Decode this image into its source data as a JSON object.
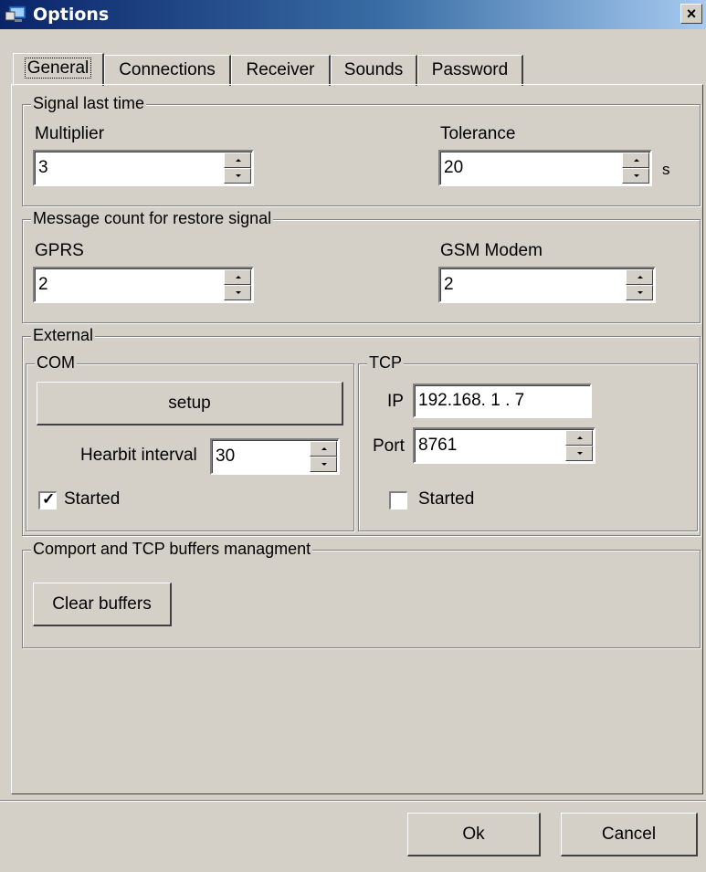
{
  "window": {
    "title": "Options",
    "close_glyph": "×",
    "icon": "monitor-app-icon"
  },
  "tabs": [
    {
      "label": "General",
      "active": true
    },
    {
      "label": "Connections",
      "active": false
    },
    {
      "label": "Receiver",
      "active": false
    },
    {
      "label": "Sounds",
      "active": false
    },
    {
      "label": "Password",
      "active": false
    }
  ],
  "signal_last_time": {
    "title": "Signal last time",
    "multiplier_label": "Multiplier",
    "multiplier_value": "3",
    "tolerance_label": "Tolerance",
    "tolerance_value": "20",
    "tolerance_unit": "s"
  },
  "message_count": {
    "title": "Message count for restore signal",
    "gprs_label": "GPRS",
    "gprs_value": "2",
    "gsm_label": "GSM Modem",
    "gsm_value": "2"
  },
  "external": {
    "title": "External",
    "com": {
      "title": "COM",
      "setup_label": "setup",
      "heartbit_label": "Hearbit interval",
      "heartbit_value": "30",
      "started_label": "Started",
      "started_checked": true,
      "check_glyph": "✓"
    },
    "tcp": {
      "title": "TCP",
      "ip_label": "IP",
      "ip_value": "192.168. 1 . 7",
      "port_label": "Port",
      "port_value": "8761",
      "started_label": "Started",
      "started_checked": false
    }
  },
  "buffers": {
    "title": "Comport and TCP  buffers managment",
    "clear_label": "Clear buffers"
  },
  "footer": {
    "ok_label": "Ok",
    "cancel_label": "Cancel"
  },
  "colors": {
    "face": "#d4d0c8",
    "title_start": "#0a246a",
    "title_end": "#a6caf0"
  }
}
